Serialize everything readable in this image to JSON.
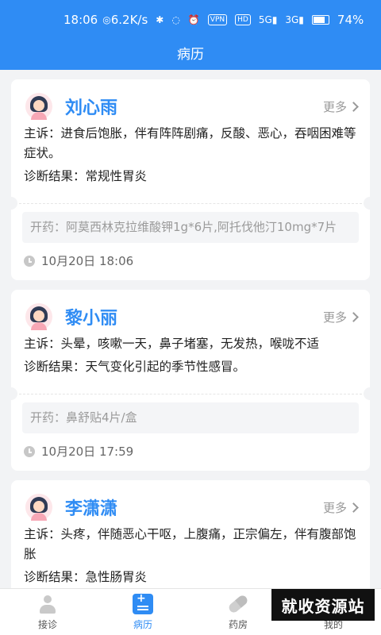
{
  "status": {
    "time": "18:06",
    "speed": "6.2K/s",
    "vpn": "VPN",
    "hd": "HD",
    "net1": "5G",
    "net2": "3G",
    "battery": "74%"
  },
  "header": {
    "title": "病历"
  },
  "records": [
    {
      "name": "刘心雨",
      "more": "更多",
      "complaint": "主诉：进食后饱胀，伴有阵阵剧痛，反酸、恶心，吞咽困难等症状。",
      "diagnosis": "诊断结果：常规性胃炎",
      "prescription": "开药：阿莫西林克拉维酸钾1g*6片,阿托伐他汀10mg*7片",
      "time": "10月20日 18:06"
    },
    {
      "name": "黎小丽",
      "more": "更多",
      "complaint": "主诉：头晕，咳嗽一天，鼻子堵塞，无发热，喉咙不适",
      "diagnosis": "诊断结果：天气变化引起的季节性感冒。",
      "prescription": "开药：鼻舒贴4片/盒",
      "time": "10月20日 17:59"
    },
    {
      "name": "李潇潇",
      "more": "更多",
      "complaint": "主诉：头疼，伴随恶心干呕，上腹痛，正宗偏左，伴有腹部饱胀",
      "diagnosis": "诊断结果：急性肠胃炎"
    }
  ],
  "tabs": [
    {
      "label": "接诊",
      "icon": "doctor-icon"
    },
    {
      "label": "病历",
      "icon": "medical-record-icon"
    },
    {
      "label": "药房",
      "icon": "pill-icon"
    },
    {
      "label": "我的",
      "icon": "user-icon"
    }
  ],
  "watermark": "就收资源站",
  "colors": {
    "primary": "#2f8cf4",
    "background": "#f2f3f5"
  }
}
